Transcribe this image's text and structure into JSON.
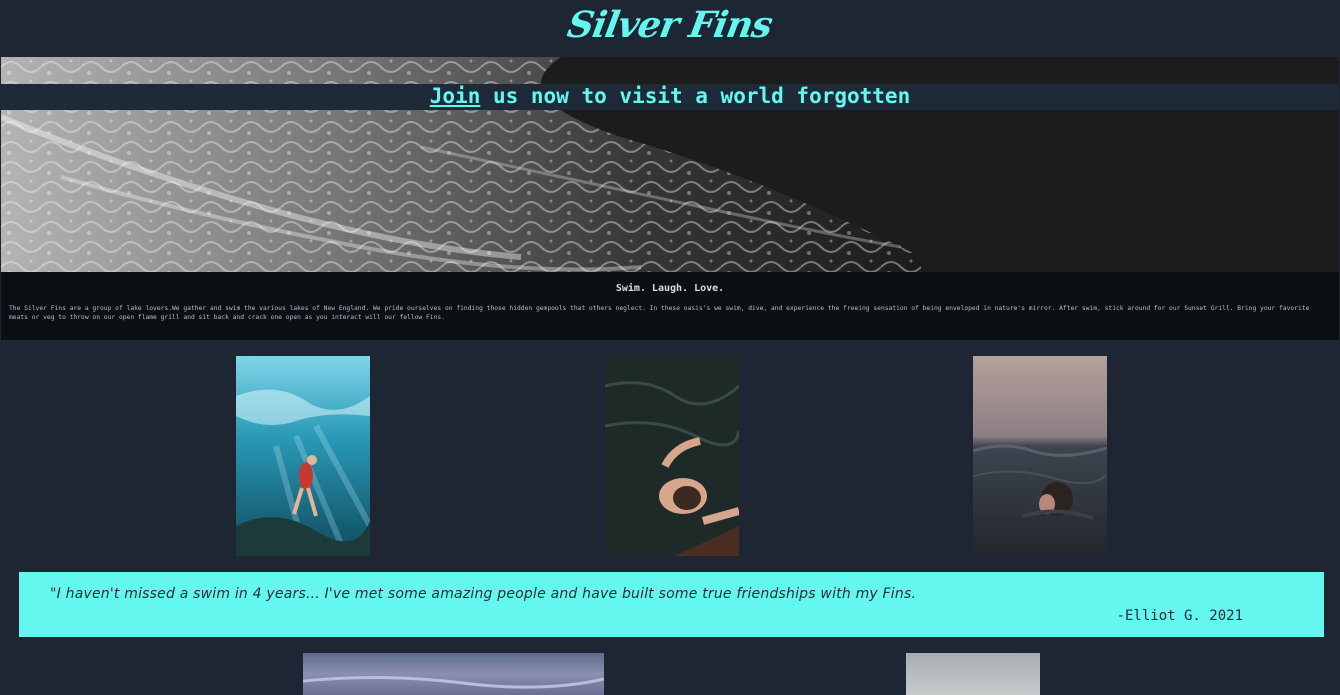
{
  "header": {
    "logo": "Silver Fins"
  },
  "hero": {
    "link_text": "Join",
    "title_rest": " us now to visit a world forgotten"
  },
  "about": {
    "heading": "Swim. Laugh. Love.",
    "body": "The Silver Fins are a group of lake lovers.We gather and swim the various lakes of New England. We pride ourselves on finding those hidden gempools that others neglect. In these oasis's we swim, dive, and experience the freeing sensation of being enveloped in nature's mirror. After swim, stick around for our Sunset Grill. Bring your favorite meats or veg to throw on our open flame grill and sit back and crack one open as you interact will our fellow Fins."
  },
  "gallery": [
    {
      "icon": "underwater-diver-photo"
    },
    {
      "icon": "swimmer-from-above-photo"
    },
    {
      "icon": "swimmer-at-sunset-photo"
    }
  ],
  "testimonial": {
    "quote": "\"I haven't missed a swim in 4 years... I've met some amazing people and have built some true friendships with my Fins.",
    "author": "-Elliot G. 2021"
  },
  "colors": {
    "accent": "#63f7ef",
    "background": "#1f2633",
    "about_bg": "#0c0f14"
  }
}
